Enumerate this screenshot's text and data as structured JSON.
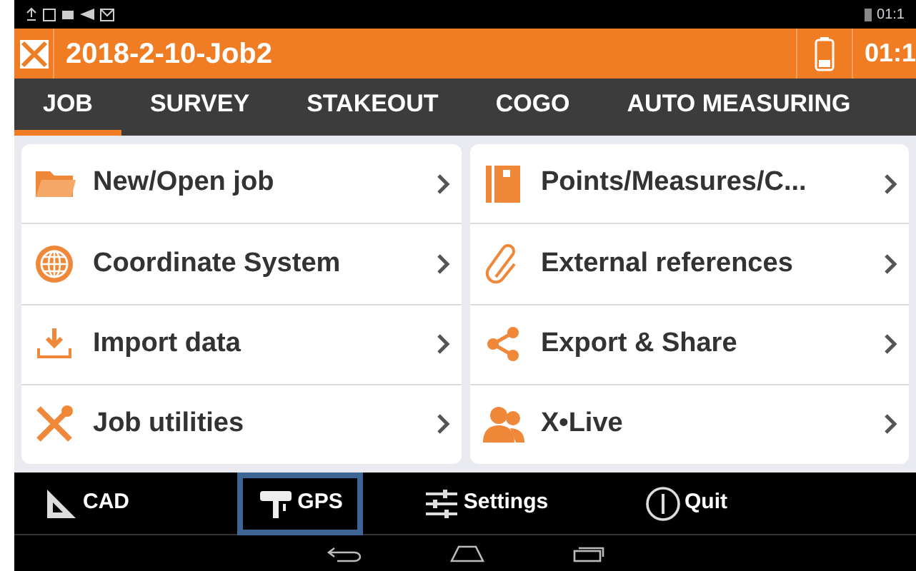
{
  "status_bar": {
    "time": "01:1"
  },
  "title_bar": {
    "title": "2018-2-10-Job2",
    "time": "01:1"
  },
  "tabs": [
    {
      "label": "JOB",
      "selected": true
    },
    {
      "label": "SURVEY",
      "selected": false
    },
    {
      "label": "STAKEOUT",
      "selected": false
    },
    {
      "label": "COGO",
      "selected": false
    },
    {
      "label": "AUTO MEASURING",
      "selected": false
    }
  ],
  "menu_columns": [
    [
      {
        "label": "New/Open job",
        "kind": "folder"
      },
      {
        "label": "Coordinate System",
        "kind": "globe"
      },
      {
        "label": "Import data",
        "kind": "import"
      },
      {
        "label": "Job utilities",
        "kind": "tools"
      }
    ],
    [
      {
        "label": "Points/Measures/C...",
        "kind": "book"
      },
      {
        "label": "External references",
        "kind": "clip"
      },
      {
        "label": "Export & Share",
        "kind": "share"
      },
      {
        "label": "X•Live",
        "kind": "people"
      }
    ]
  ],
  "bottom_bar": [
    {
      "label": "CAD",
      "kind": "cad",
      "selected": false
    },
    {
      "label": "GPS",
      "kind": "gps",
      "selected": true
    },
    {
      "label": "Settings",
      "kind": "settings",
      "selected": false
    },
    {
      "label": "Quit",
      "kind": "quit",
      "selected": false
    }
  ]
}
